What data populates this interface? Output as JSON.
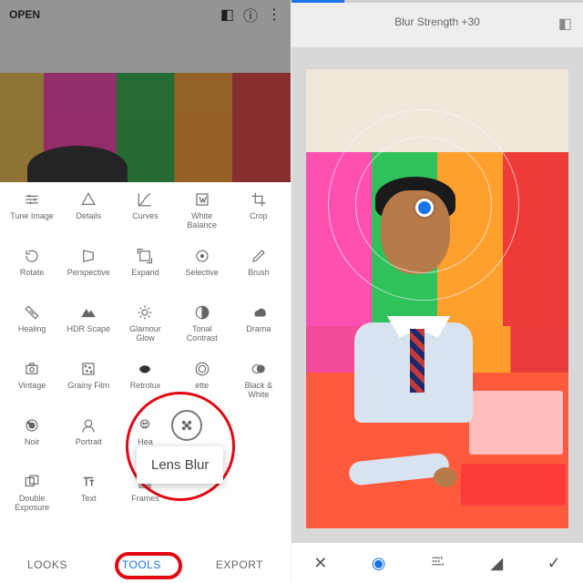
{
  "left": {
    "open": "OPEN",
    "tools": [
      {
        "icon": "tune",
        "label": "Tune Image"
      },
      {
        "icon": "details",
        "label": "Details"
      },
      {
        "icon": "curves",
        "label": "Curves"
      },
      {
        "icon": "wb",
        "label": "White\nBalance"
      },
      {
        "icon": "crop",
        "label": "Crop"
      },
      {
        "icon": "rotate",
        "label": "Rotate"
      },
      {
        "icon": "perspective",
        "label": "Perspective"
      },
      {
        "icon": "expand",
        "label": "Expand"
      },
      {
        "icon": "selective",
        "label": "Selective"
      },
      {
        "icon": "brush",
        "label": "Brush"
      },
      {
        "icon": "healing",
        "label": "Healing"
      },
      {
        "icon": "hdr",
        "label": "HDR Scape"
      },
      {
        "icon": "glamour",
        "label": "Glamour\nGlow"
      },
      {
        "icon": "tonal",
        "label": "Tonal\nContrast"
      },
      {
        "icon": "drama",
        "label": "Drama"
      },
      {
        "icon": "vintage",
        "label": "Vintage"
      },
      {
        "icon": "grainy",
        "label": "Grainy Film"
      },
      {
        "icon": "retrolux",
        "label": "Retrolux"
      },
      {
        "icon": "grunge",
        "label": "ette"
      },
      {
        "icon": "bw",
        "label": "Black &\nWhite"
      },
      {
        "icon": "noir",
        "label": "Noir"
      },
      {
        "icon": "portrait",
        "label": "Portrait"
      },
      {
        "icon": "head",
        "label": "Hea"
      },
      {
        "icon": "blank",
        "label": ""
      },
      {
        "icon": "blank",
        "label": ""
      },
      {
        "icon": "double",
        "label": "Double\nExposure"
      },
      {
        "icon": "text",
        "label": "Text"
      },
      {
        "icon": "frames",
        "label": "Frames"
      },
      {
        "icon": "blank",
        "label": ""
      },
      {
        "icon": "blank",
        "label": ""
      }
    ],
    "tooltip": "Lens Blur",
    "tabs": {
      "looks": "LOOKS",
      "tools": "TOOLS",
      "export": "EXPORT"
    }
  },
  "right": {
    "status": "Blur Strength +30"
  }
}
